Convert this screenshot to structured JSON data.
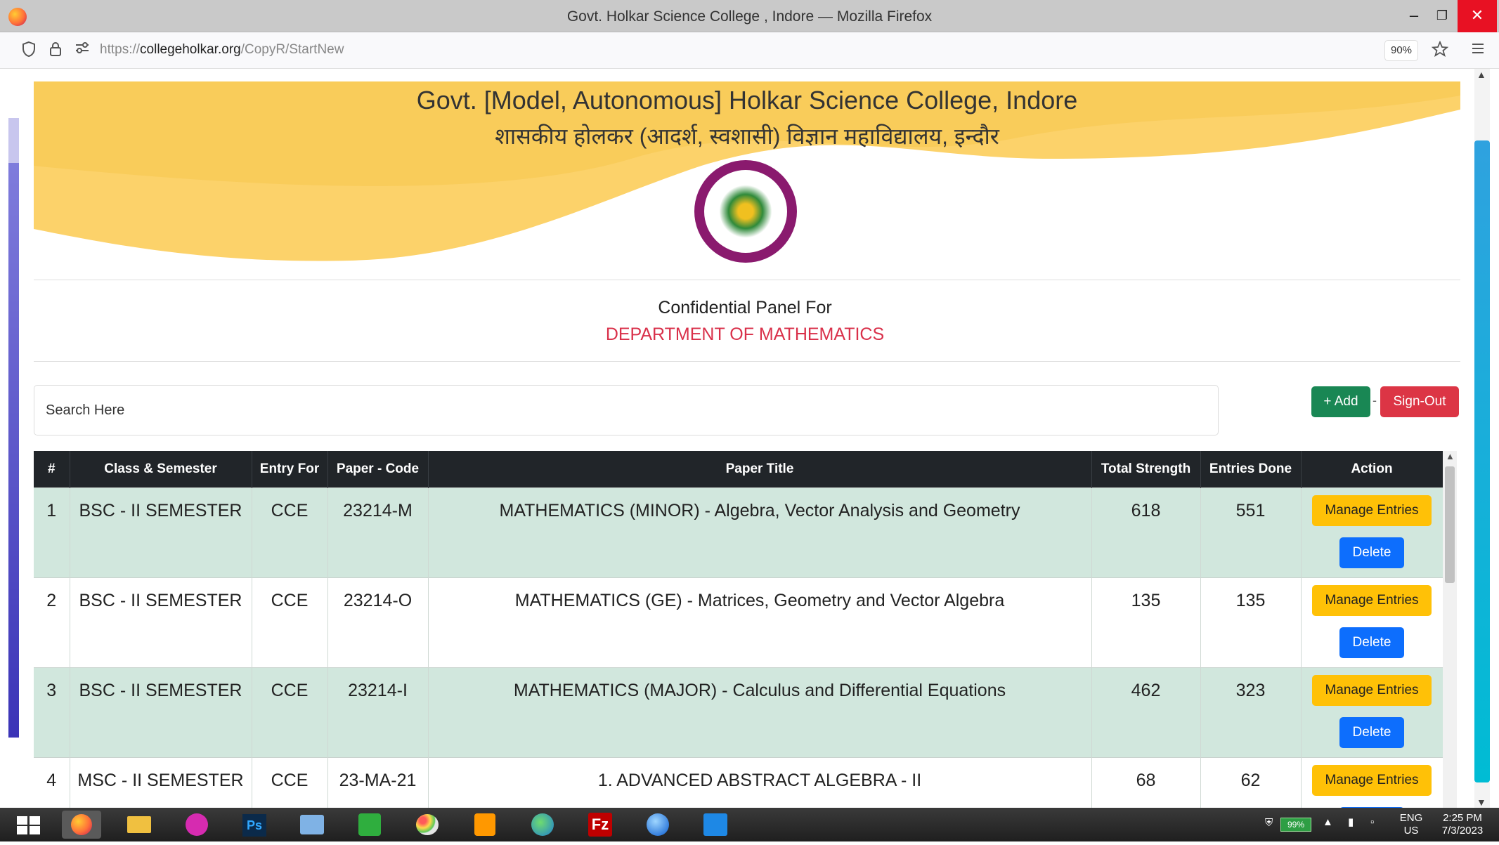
{
  "window": {
    "title": "Govt. Holkar Science College , Indore — Mozilla Firefox",
    "controls": [
      "minimize",
      "restore",
      "close"
    ]
  },
  "navbar": {
    "url_prefix": "https://",
    "url_domain": "collegeholkar.org",
    "url_path": "/CopyR/StartNew",
    "zoom": "90%",
    "icons": [
      "shield-icon",
      "lock-icon",
      "permissions-icon",
      "star-icon",
      "menu-icon"
    ]
  },
  "header": {
    "college_name_en": "Govt. [Model, Autonomous] Holkar Science College, Indore",
    "college_name_hi": "शासकीय होलकर (आदर्श, स्वशासी) विज्ञान महाविद्यालय, इन्दौर",
    "banner_color": "#fcd26a"
  },
  "panel": {
    "label": "Confidential Panel For",
    "department": "DEPARTMENT OF MATHEMATICS"
  },
  "toolbar": {
    "search_placeholder": "Search Here",
    "add_label": "+ Add",
    "separator": "-",
    "signout_label": "Sign-Out"
  },
  "table": {
    "headers": [
      "#",
      "Class & Semester",
      "Entry For",
      "Paper - Code",
      "Paper Title",
      "Total Strength",
      "Entries Done",
      "Action"
    ],
    "manage_label": "Manage Entries",
    "delete_label": "Delete",
    "rows": [
      {
        "num": "1",
        "class": "BSC - II SEMESTER",
        "entry": "CCE",
        "code": "23214-M",
        "title": "MATHEMATICS (MINOR) - Algebra, Vector Analysis and Geometry",
        "strength": "618",
        "done": "551"
      },
      {
        "num": "2",
        "class": "BSC - II SEMESTER",
        "entry": "CCE",
        "code": "23214-O",
        "title": "MATHEMATICS (GE) - Matrices, Geometry and Vector Algebra",
        "strength": "135",
        "done": "135"
      },
      {
        "num": "3",
        "class": "BSC - II SEMESTER",
        "entry": "CCE",
        "code": "23214-I",
        "title": "MATHEMATICS (MAJOR) - Calculus and Differential Equations",
        "strength": "462",
        "done": "323"
      },
      {
        "num": "4",
        "class": "MSC - II SEMESTER",
        "entry": "CCE",
        "code": "23-MA-21",
        "title": "1. ADVANCED ABSTRACT ALGEBRA - II",
        "strength": "68",
        "done": "62"
      }
    ]
  },
  "taskbar": {
    "apps": [
      "Firefox",
      "File Explorer",
      "Wondershare",
      "Ps",
      "Control Panel",
      "Camtasia",
      "Paint",
      "Sublime Text",
      "Globe",
      "FileZilla",
      "Thunderbird",
      "Network"
    ],
    "battery": "99%",
    "lang_top": "ENG",
    "lang_bottom": "US",
    "time": "2:25 PM",
    "date": "7/3/2023"
  }
}
